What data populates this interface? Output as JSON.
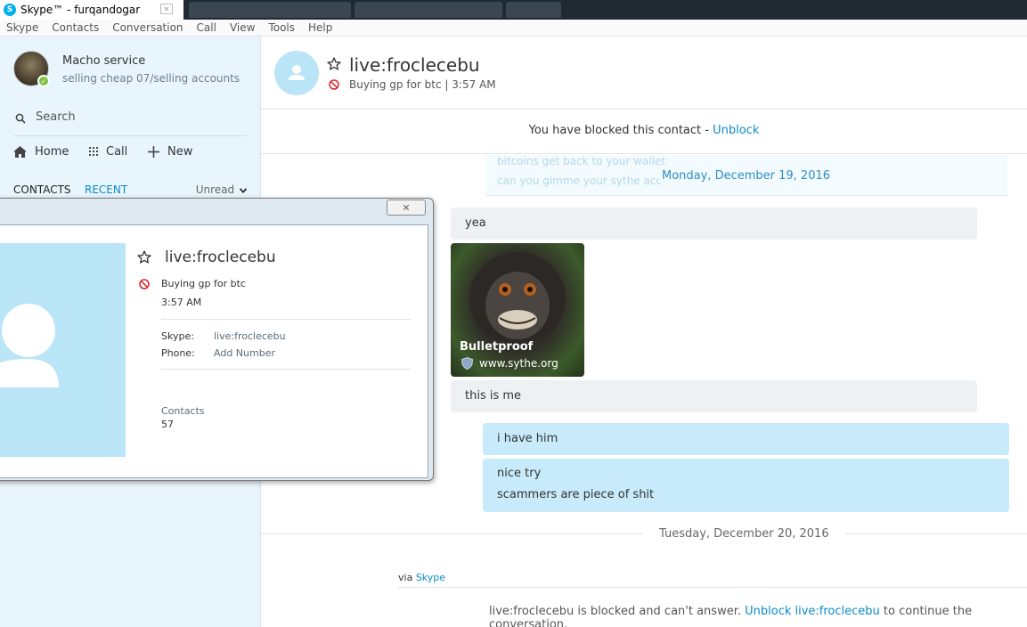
{
  "window": {
    "title": "Skype™ - furqandogar"
  },
  "menu": [
    "Skype",
    "Contacts",
    "Conversation",
    "Call",
    "View",
    "Tools",
    "Help"
  ],
  "profile": {
    "name": "Macho service",
    "mood": "selling cheap 07/selling accounts"
  },
  "search": {
    "placeholder": "Search"
  },
  "nav": {
    "home": "Home",
    "call": "Call",
    "new": "New"
  },
  "tabs": {
    "contacts": "CONTACTS",
    "recent": "RECENT",
    "filter": "Unread"
  },
  "chat": {
    "name": "live:froclecebu",
    "mood": "Buying gp for btc",
    "time": "3:57 AM",
    "blocked_text": "You have blocked this contact - ",
    "unblock": "Unblock",
    "faded_line1": "bitcoins get back to your wallet",
    "faded_line2": "can you gimme your sythe acc",
    "date1": "Monday, December 19, 2016",
    "msg_yea": "yea",
    "image_title": "Bulletproof",
    "image_source": "www.sythe.org",
    "msg_this_is_me": "this is me",
    "msg_i_have_him": "i have him",
    "msg_nice_try": "nice try",
    "msg_scammers": "scammers are piece of shit",
    "date2": "Tuesday, December 20, 2016",
    "via": "via",
    "via_link": "Skype",
    "footer_prefix": "live:froclecebu is blocked and can't answer. ",
    "footer_link": "Unblock live:froclecebu",
    "footer_suffix": " to continue the conversation."
  },
  "popup": {
    "name": "live:froclecebu",
    "mood": "Buying gp for btc",
    "time": "3:57 AM",
    "skype_label": "Skype:",
    "skype_value": "live:froclecebu",
    "phone_label": "Phone:",
    "phone_value": "Add Number",
    "contacts_label": "Contacts",
    "contacts_value": "57"
  },
  "colors": {
    "accent": "#00aff0",
    "link": "#0a8ac8",
    "sidebar_bg": "#e9f5fc",
    "bubble_out": "#c7ebfa",
    "bubble_in": "#eef1f4",
    "blocked": "#d9222a"
  }
}
